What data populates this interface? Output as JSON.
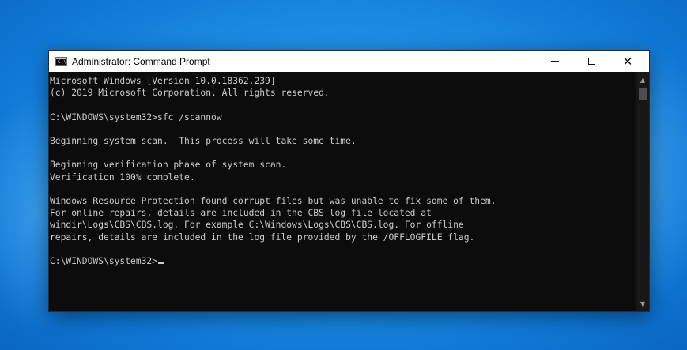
{
  "window": {
    "title": "Administrator: Command Prompt",
    "icon": "command-prompt-icon",
    "icon_glyph": "C:\\",
    "minimize_glyph": "—",
    "maximize_glyph": "☐",
    "close_glyph": "✕"
  },
  "console": {
    "lines": [
      "Microsoft Windows [Version 10.0.18362.239]",
      "(c) 2019 Microsoft Corporation. All rights reserved.",
      "",
      "C:\\WINDOWS\\system32>sfc /scannow",
      "",
      "Beginning system scan.  This process will take some time.",
      "",
      "Beginning verification phase of system scan.",
      "Verification 100% complete.",
      "",
      "Windows Resource Protection found corrupt files but was unable to fix some of them.",
      "For online repairs, details are included in the CBS log file located at",
      "windir\\Logs\\CBS\\CBS.log. For example C:\\Windows\\Logs\\CBS\\CBS.log. For offline",
      "repairs, details are included in the log file provided by the /OFFLOGFILE flag.",
      "",
      "C:\\WINDOWS\\system32>"
    ]
  },
  "scrollbar": {
    "up_icon": "chevron-up-icon",
    "down_icon": "chevron-down-icon",
    "up_glyph": "▲",
    "down_glyph": "▼"
  },
  "colors": {
    "console_background": "#0c0c0c",
    "console_text": "#cccccc",
    "titlebar_background": "#ffffff",
    "desktop_blue": "#1f8fe6"
  }
}
